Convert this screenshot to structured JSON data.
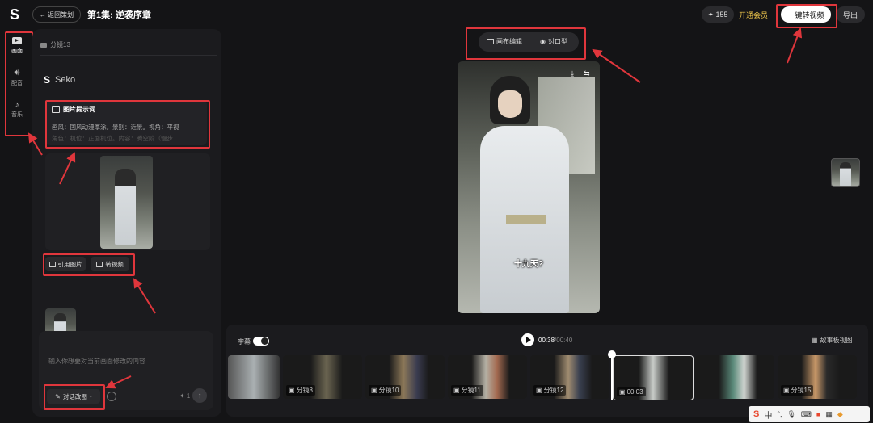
{
  "header": {
    "back_label": "← 返回策划",
    "episode_title": "第1集: 逆袭序章",
    "credits": "✦ 155",
    "member_label": "开通会员",
    "one_click_label": "一键转视频",
    "export_label": "导出"
  },
  "sidebar": {
    "items": [
      {
        "label": "画面",
        "icon": "video-icon"
      },
      {
        "label": "配音",
        "icon": "speaker-icon"
      },
      {
        "label": "音乐",
        "icon": "music-icon"
      }
    ]
  },
  "left_panel": {
    "segment_label": "分镜13",
    "brand": "Seko",
    "prompt_title": "图片提示词",
    "prompt_line1": "画风：国风动漫厚涂。景别：近景。视角：平视",
    "prompt_line2": "角色：机位：正面机位。内容：腾空阶（慢步",
    "ref_image_label": "引用图片",
    "to_video_label": "转视频",
    "chat_placeholder": "输入你想要对当前画面修改的内容",
    "edit_mode_label": "对话改图",
    "counter": "1"
  },
  "preview": {
    "tab_canvas": "画布编辑",
    "tab_compare": "对口型",
    "subtitle": "十九天?"
  },
  "timeline": {
    "subtitle_toggle_label": "字幕",
    "time_current": "00:38",
    "time_total": "/00:40",
    "storyboard_label": "故事板视图",
    "clips": [
      {
        "label": ""
      },
      {
        "label": "分镜8"
      },
      {
        "label": "分镜10"
      },
      {
        "label": "分镜11"
      },
      {
        "label": "分镜12"
      },
      {
        "label": "00:03"
      },
      {
        "label": ""
      },
      {
        "label": "分镜15"
      }
    ]
  },
  "taskbar": {
    "lang": "中",
    "items": [
      "S",
      "中",
      "°,",
      "mic",
      "kbd",
      "bag",
      "grid",
      "bird"
    ]
  }
}
